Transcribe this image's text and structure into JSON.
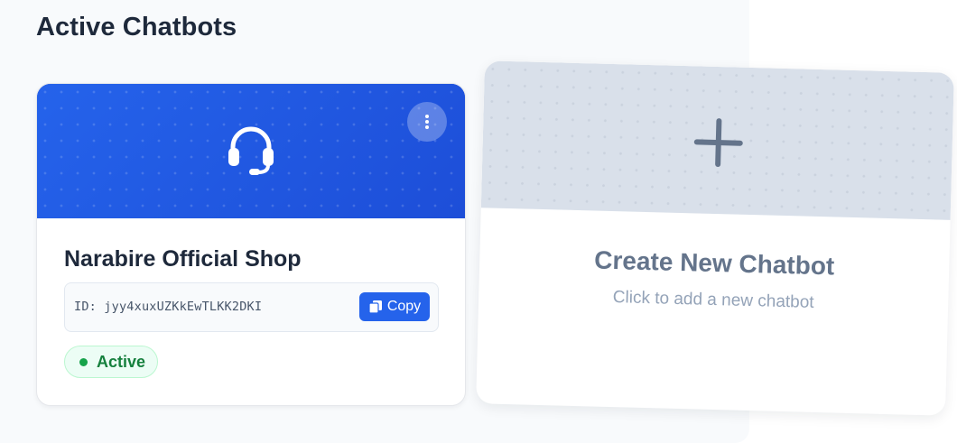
{
  "page": {
    "title": "Active Chatbots"
  },
  "bot_card": {
    "name": "Narabire Official Shop",
    "id_text": "ID: jyy4xuxUZKkEwTLKK2DKI",
    "copy_label": "Copy",
    "status": "Active",
    "icon": "headset-icon",
    "menu_icon": "more-vertical-icon",
    "banner_color": "#1d4ed8",
    "status_color": "#16a34a"
  },
  "create_card": {
    "title": "Create New Chatbot",
    "subtitle": "Click to add a new chatbot",
    "icon": "plus-icon"
  },
  "colors": {
    "accent": "#2563eb",
    "heading": "#1e293b",
    "muted": "#64748b"
  }
}
